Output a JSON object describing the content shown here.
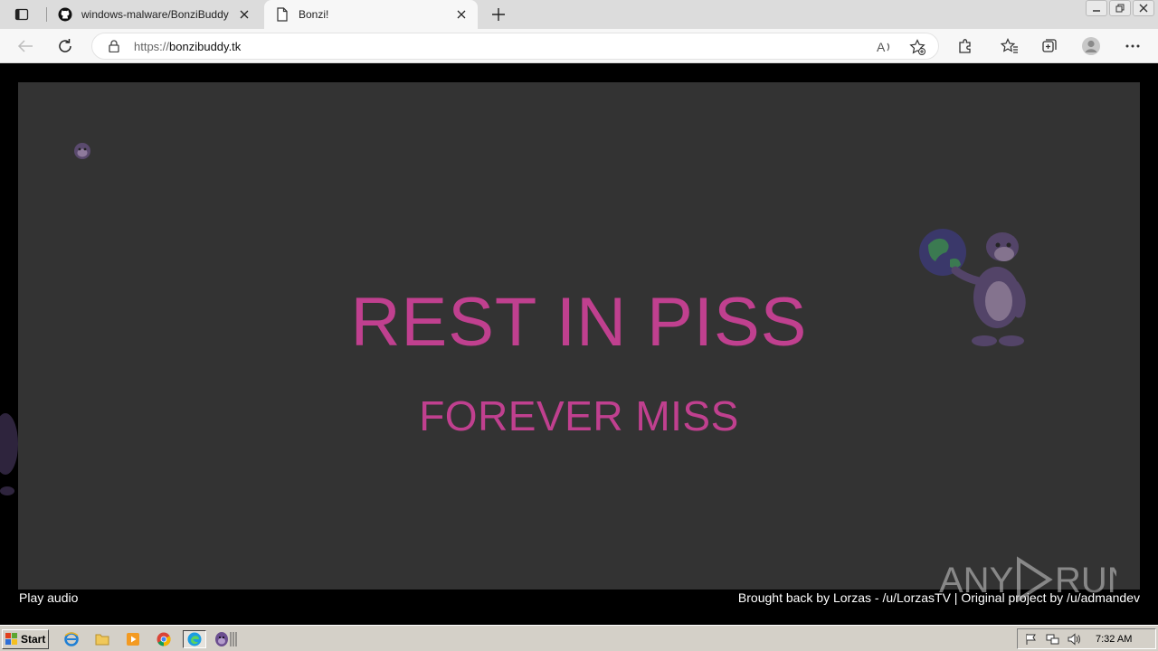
{
  "browser": {
    "tabs": [
      {
        "title": "windows-malware/BonziBuddy",
        "icon": "github-icon"
      },
      {
        "title": "Bonzi!",
        "icon": "page-icon"
      }
    ],
    "address": {
      "protocol": "https://",
      "host": "bonzibuddy.tk"
    }
  },
  "page": {
    "headline": "REST IN PISS",
    "subheadline": "FOREVER MISS",
    "play_audio": "Play audio",
    "credits": "Brought back by Lorzas - /u/LorzasTV | Original project by /u/admandev",
    "text_color": "#c0408f",
    "background": "#333333"
  },
  "watermark": {
    "text": "ANY RUN"
  },
  "taskbar": {
    "start_label": "Start",
    "clock": "7:32 AM",
    "apps": [
      "ie-icon",
      "explorer-icon",
      "media-player-icon",
      "chrome-icon",
      "edge-icon",
      "bonzi-icon"
    ]
  }
}
